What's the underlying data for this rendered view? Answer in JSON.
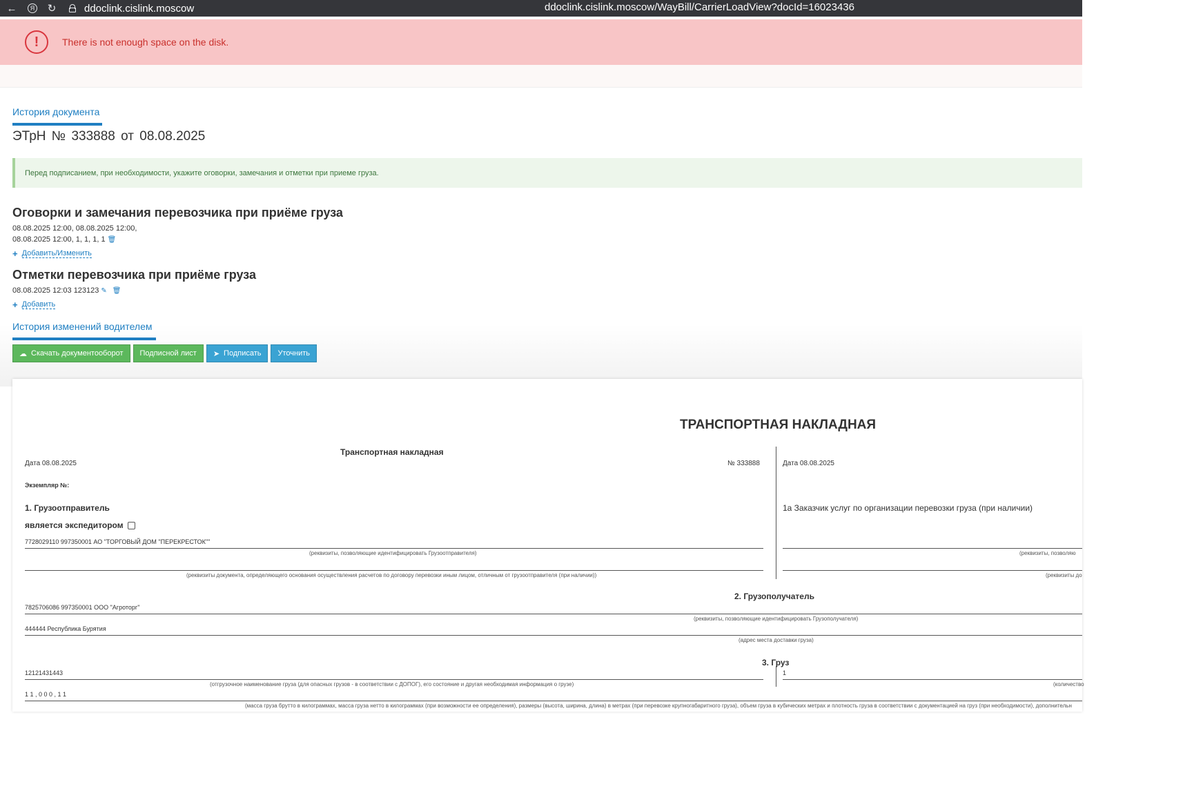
{
  "browser": {
    "domain": "ddoclink.cislink.moscow",
    "url": "ddoclink.cislink.moscow/WayBill/CarrierLoadView?docId=16023436"
  },
  "error": {
    "message": "There is not enough space on the disk."
  },
  "tabs": {
    "history": "История документа",
    "driver_history": "История изменений водителем"
  },
  "doc": {
    "prefix": "ЭТрН №",
    "number": "333888",
    "from": "от",
    "date": "08.08.2025"
  },
  "info": "Перед подписанием, при необходимости, укажите оговорки, замечания и отметки при приеме груза.",
  "reservations": {
    "title": "Оговорки и замечания перевозчика при приёме груза",
    "line1": "08.08.2025  12:00, 08.08.2025  12:00,",
    "line2": "08.08.2025  12:00, 1, 1, 1, 1",
    "add_label": "Добавить/Изменить"
  },
  "marks": {
    "title": "Отметки перевозчика при приёме груза",
    "entry": "08.08.2025 12:03 123123",
    "add_label": "Добавить"
  },
  "buttons": {
    "download": "Скачать документооборот",
    "sign_sheet": "Подписной лист",
    "sign": "Подписать",
    "clarify": "Уточнить"
  },
  "form": {
    "main_title": "ТРАНСПОРТНАЯ НАКЛАДНАЯ",
    "sub_title": "Транспортная накладная",
    "date_left": "Дата  08.08.2025",
    "number_label": "№   333888",
    "date_right": "Дата 08.08.2025",
    "copy_label": "Экземпляр №:",
    "shipper_title": "1. Грузоотправитель",
    "is_forwarder": "является экспедитором",
    "shipper_value": "7728029110 997350001 АО \"ТОРГОВЫЙ ДОМ \"ПЕРЕКРЕСТОК\"\"",
    "shipper_caption": "(реквизиты, позволяющие идентифицировать Грузоотправителя)",
    "payer_caption": "(реквизиты документа, определяющего основания осуществления расчетов по договору перевозки иным лицом, отличным от грузоотправителя (при наличии))",
    "customer_title": "1а Заказчик услуг по организации перевозки груза (при наличии)",
    "customer_caption1": "(реквизиты, позволяю",
    "customer_caption2": "(реквизиты до",
    "consignee_title": "2. Грузополучатель",
    "consignee_value": "7825706086 997350001 ООО \"Агроторг\"",
    "consignee_caption": "(реквизиты, позволяющие идентифицировать Грузополучателя)",
    "address_value": "444444 Республика Бурятия",
    "address_caption": "(адрес места доставки груза)",
    "cargo_title": "3. Груз",
    "cargo_value": "12121431443",
    "cargo_right_value": "1",
    "cargo_caption": "(отгрузочное наименование груза (для опасных грузов - в соответствии с ДОПОГ), его состояние и другая необходимая информация о грузе)",
    "cargo_right_caption": "(количество",
    "mass_value": "1 1 , 0 0 0 , 1 1",
    "mass_caption": "(масса груза брутто в килограммах, масса груза нетто в килограммах (при возможности ее определения), размеры (высота, ширина, длина) в метрах (при перевозке крупногабаритного груза), объем груза в кубических метрах и плотность груза в соответствии с документацией на груз (при необходимости), дополнительн"
  }
}
